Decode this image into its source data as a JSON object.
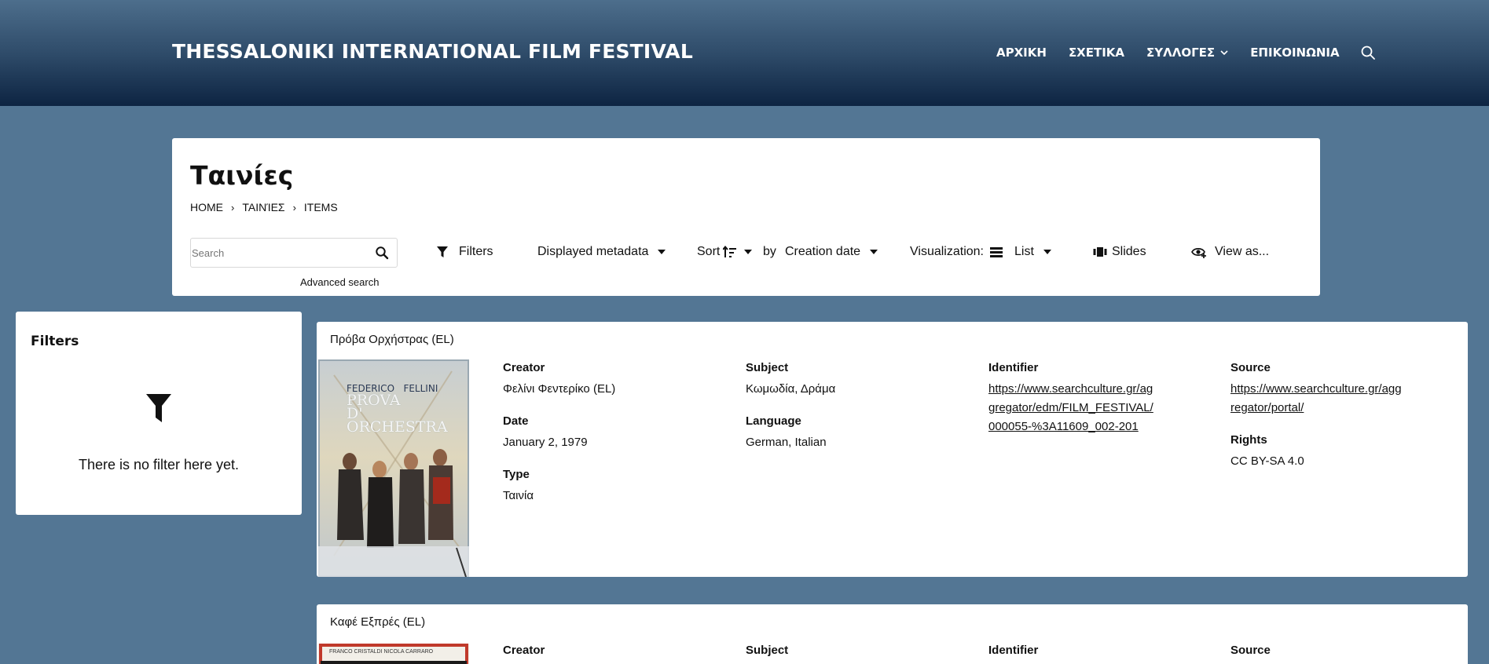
{
  "header": {
    "site_title": "THESSALONIKI INTERNATIONAL FILM FESTIVAL",
    "nav": [
      {
        "label": "ΑΡΧΙΚΗ"
      },
      {
        "label": "ΣΧΕΤΙΚΑ"
      },
      {
        "label": "ΣΥΛΛΟΓΕΣ"
      },
      {
        "label": "ΕΠΙΚΟΙΝΩΝΙΑ"
      }
    ]
  },
  "page": {
    "title": "Ταινίες",
    "breadcrumb": [
      "HOME",
      "ΤΑΙΝΊΕΣ",
      "ITEMS"
    ],
    "search_placeholder": "Search",
    "advanced_search": "Advanced search",
    "toolbar": {
      "filters": "Filters",
      "displayed_metadata": "Displayed metadata",
      "sort": "Sort",
      "by": "by",
      "sort_field": "Creation date",
      "visualization": "Visualization:",
      "list": "List",
      "slides": "Slides",
      "view_as": "View as..."
    }
  },
  "filters": {
    "title": "Filters",
    "empty_text": "There is no filter here yet."
  },
  "items": [
    {
      "title": "Πρόβα Ορχήστρας (EL)",
      "thumb": {
        "line1": "FEDERICO   FELLINI",
        "line2": "PROVA",
        "line3": "D'",
        "line4": "ORCHESTRA"
      },
      "creator_label": "Creator",
      "creator": "Φελίνι Φεντερίκο (EL)",
      "date_label": "Date",
      "date": "January 2, 1979",
      "type_label": "Type",
      "type": "Ταινία",
      "subject_label": "Subject",
      "subject": "Κωμωδία, Δράμα",
      "language_label": "Language",
      "language": "German, Italian",
      "identifier_label": "Identifier",
      "identifier": "https://www.searchculture.gr/aggregator/edm/FILM_FESTIVAL/000055-%3A11609_002-201",
      "source_label": "Source",
      "source": "https://www.searchculture.gr/aggregator/portal/",
      "rights_label": "Rights",
      "rights": "CC BY-SA 4.0"
    },
    {
      "title": "Καφέ Εξπρές (EL)",
      "thumb": {
        "line1": "FRANCO CRISTALDI  NICOLA CARRARO"
      },
      "creator_label": "Creator",
      "subject_label": "Subject",
      "identifier_label": "Identifier",
      "source_label": "Source"
    }
  ],
  "colors": {
    "background": "#537694",
    "header_top": "#4d6e8c",
    "header_bottom": "#0d2442"
  }
}
